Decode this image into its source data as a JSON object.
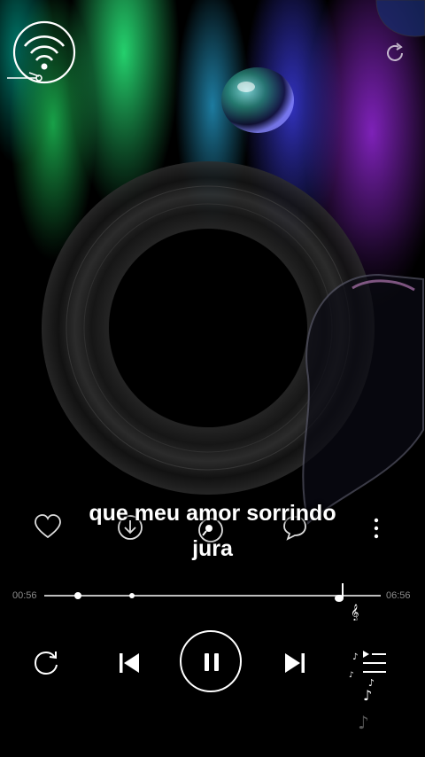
{
  "lyrics": {
    "line1": "que meu amor sorrindo",
    "line2": "jura"
  },
  "player": {
    "current_time": "00:56",
    "total_time": "06:56",
    "progress": 0.135,
    "state": "playing"
  },
  "icons": {
    "cast": "wifi-cast-icon",
    "refresh": "refresh-icon",
    "favorite": "heart-icon",
    "download": "download-icon",
    "search": "search-icon",
    "comments": "comment-icon",
    "more": "more-vertical-icon",
    "repeat": "repeat-icon",
    "previous": "skip-previous-icon",
    "pause": "pause-icon",
    "next": "skip-next-icon",
    "playlist": "playlist-icon"
  },
  "colors": {
    "background": "#000000",
    "text": "#ffffff",
    "muted_time": "#8a8a8a"
  }
}
